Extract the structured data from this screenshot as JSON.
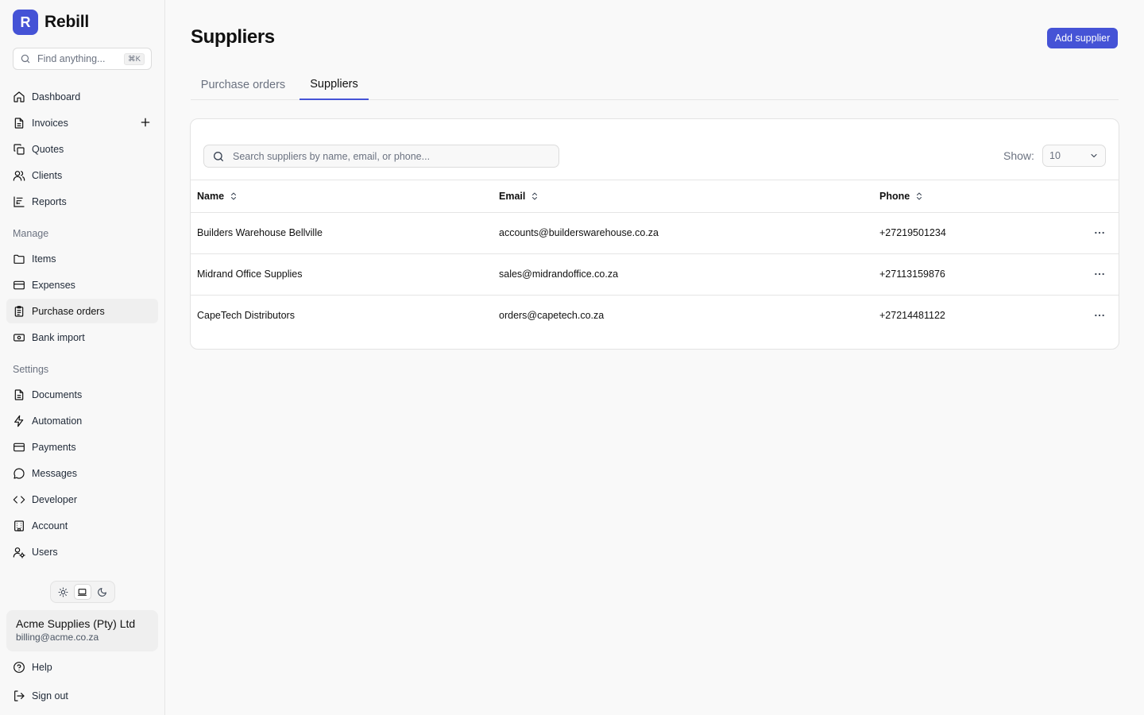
{
  "brand": {
    "logo_letter": "R",
    "name": "Rebill",
    "color": "#4553d6"
  },
  "search": {
    "placeholder": "Find anything...",
    "shortcut": "⌘K"
  },
  "nav": {
    "main": [
      {
        "label": "Dashboard",
        "icon": "home-icon"
      },
      {
        "label": "Invoices",
        "icon": "file-text-icon"
      },
      {
        "label": "Quotes",
        "icon": "copy-icon"
      },
      {
        "label": "Clients",
        "icon": "users-icon"
      },
      {
        "label": "Reports",
        "icon": "bar-chart-icon"
      }
    ],
    "manage_label": "Manage",
    "manage": [
      {
        "label": "Items",
        "icon": "folder-icon"
      },
      {
        "label": "Expenses",
        "icon": "credit-card-icon"
      },
      {
        "label": "Purchase orders",
        "icon": "clipboard-icon",
        "active": true
      },
      {
        "label": "Bank import",
        "icon": "banknote-icon"
      }
    ],
    "settings_label": "Settings",
    "settings": [
      {
        "label": "Documents",
        "icon": "file-text-icon"
      },
      {
        "label": "Automation",
        "icon": "zap-icon"
      },
      {
        "label": "Payments",
        "icon": "credit-card-icon"
      },
      {
        "label": "Messages",
        "icon": "message-circle-icon"
      },
      {
        "label": "Developer",
        "icon": "code-icon"
      },
      {
        "label": "Account",
        "icon": "building-icon"
      },
      {
        "label": "Users",
        "icon": "user-cog-icon"
      }
    ],
    "footer": [
      {
        "label": "Help",
        "icon": "help-circle-icon"
      },
      {
        "label": "Sign out",
        "icon": "log-out-icon"
      }
    ]
  },
  "theme": {
    "selected": "system"
  },
  "account": {
    "name": "Acme Supplies (Pty) Ltd",
    "email": "billing@acme.co.za"
  },
  "page": {
    "title": "Suppliers",
    "add_button": "Add supplier",
    "tabs": [
      {
        "label": "Purchase orders",
        "active": false
      },
      {
        "label": "Suppliers",
        "active": true
      }
    ]
  },
  "table": {
    "search_placeholder": "Search suppliers by name, email, or phone...",
    "show_label": "Show:",
    "show_value": "10",
    "columns": [
      "Name",
      "Email",
      "Phone"
    ],
    "rows": [
      {
        "name": "Builders Warehouse Bellville",
        "email": "accounts@builderswarehouse.co.za",
        "phone": "+27219501234"
      },
      {
        "name": "Midrand Office Supplies",
        "email": "sales@midrandoffice.co.za",
        "phone": "+27113159876"
      },
      {
        "name": "CapeTech Distributors",
        "email": "orders@capetech.co.za",
        "phone": "+27214481122"
      }
    ]
  }
}
